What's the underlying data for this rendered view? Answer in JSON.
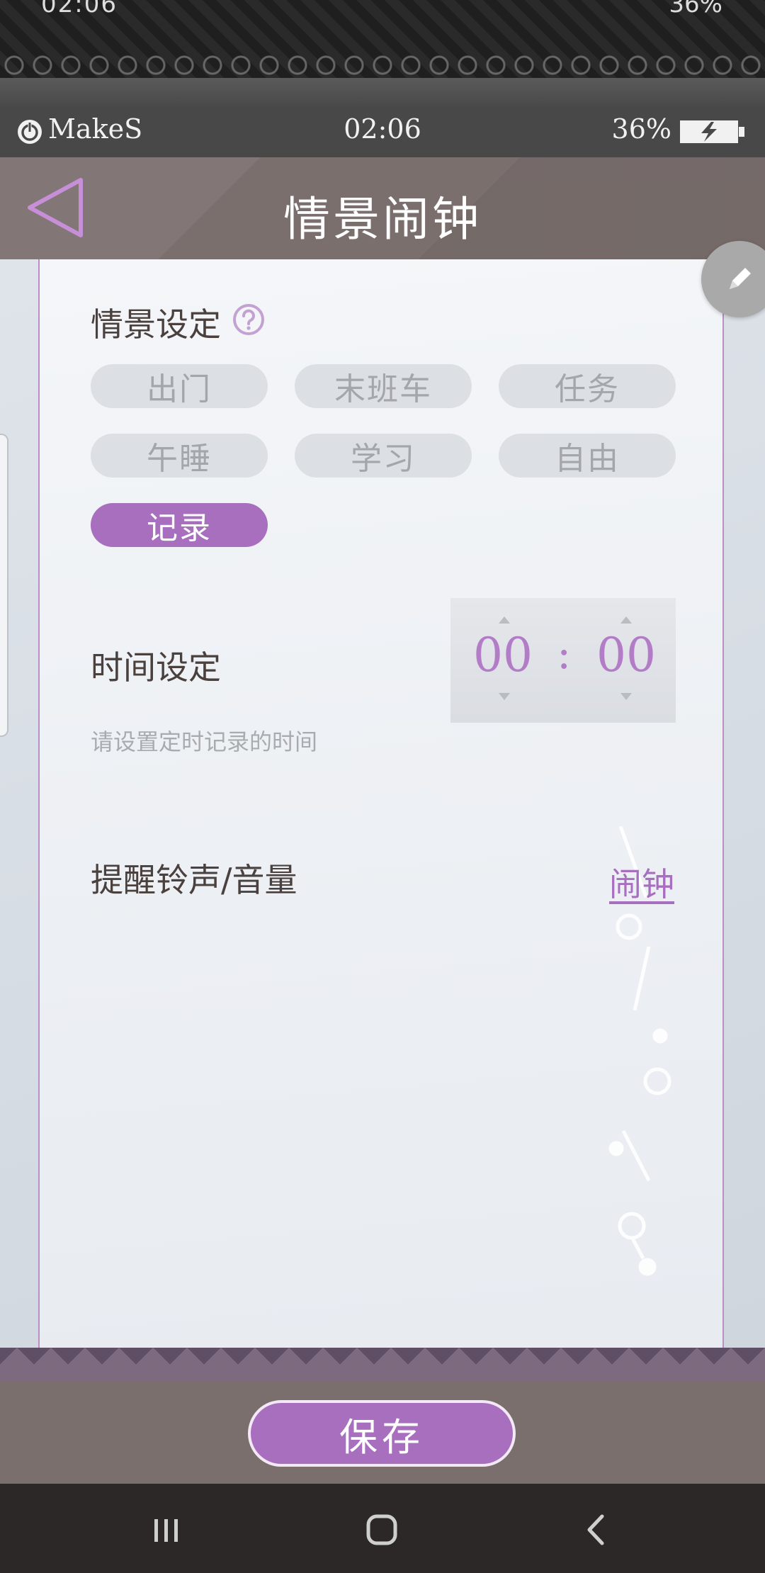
{
  "system_bar": {
    "time": "02:06",
    "right": "36%"
  },
  "app_status": {
    "brand": "MakeS",
    "clock": "02:06",
    "battery": "36%"
  },
  "header": {
    "title": "情景闹钟"
  },
  "scenario": {
    "label": "情景设定",
    "options": [
      {
        "label": "出门",
        "selected": false
      },
      {
        "label": "末班车",
        "selected": false
      },
      {
        "label": "任务",
        "selected": false
      },
      {
        "label": "午睡",
        "selected": false
      },
      {
        "label": "学习",
        "selected": false
      },
      {
        "label": "自由",
        "selected": false
      },
      {
        "label": "记录",
        "selected": true
      }
    ]
  },
  "time_setting": {
    "label": "时间设定",
    "hours": "00",
    "colon": ":",
    "minutes": "00",
    "hint": "请设置定时记录的时间"
  },
  "ringtone": {
    "label": "提醒铃声/音量",
    "value": "闹钟"
  },
  "footer": {
    "save_label": "保存"
  },
  "colors": {
    "accent": "#a86fbf",
    "header_bg": "#7a6f6d"
  }
}
